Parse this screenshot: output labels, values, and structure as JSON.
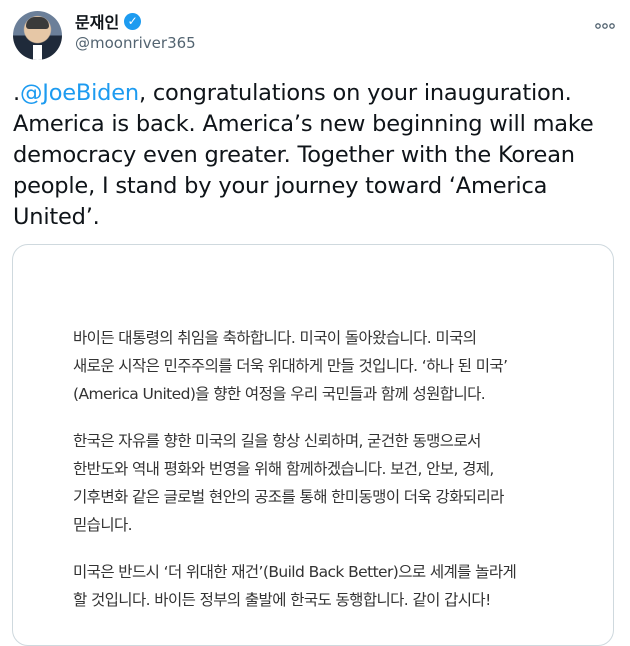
{
  "author": {
    "display_name": "문재인",
    "handle": "@moonriver365",
    "verified_icon": "verified-badge-icon"
  },
  "menu": {
    "more_glyph": "⊙⊙⊙"
  },
  "tweet": {
    "lines": [
      {
        "prefix": ".",
        "mention": "@JoeBiden",
        "text": ", congratulations on your inauguration."
      },
      {
        "text": "America is back. America’s new beginning will make"
      },
      {
        "text": "democracy even greater. Together with the Korean"
      },
      {
        "text": "people, I stand by your journey toward ‘America"
      },
      {
        "text": "United’."
      }
    ]
  },
  "media": {
    "paragraphs": [
      [
        "바이든 대통령의 취임을 축하합니다. 미국이 돌아왔습니다. 미국의",
        "새로운 시작은 민주주의를 더욱 위대하게 만들 것입니다. ‘하나 된 미국’",
        "(America United)을 향한 여정을 우리 국민들과 함께 성원합니다."
      ],
      [
        "한국은 자유를 향한 미국의 길을 항상 신뢰하며, 굳건한 동맹으로서",
        "한반도와 역내 평화와 번영을 위해 함께하겠습니다. 보건, 안보, 경제,",
        "기후변화 같은 글로벌 현안의 공조를 통해 한미동맹이 더욱 강화되리라",
        "믿습니다."
      ],
      [
        "미국은 반드시 ‘더 위대한 재건’(Build Back Better)으로 세계를 놀라게",
        "할 것입니다. 바이든 정부의 출발에 한국도 동행합니다. 같이 갑시다!"
      ]
    ]
  },
  "colors": {
    "accent": "#1d9bf0",
    "text": "#0f1419",
    "secondary": "#536471",
    "border": "#cfd9de"
  }
}
